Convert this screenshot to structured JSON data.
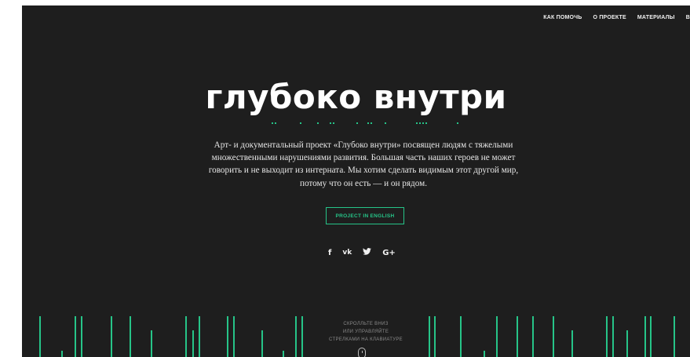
{
  "nav": {
    "items": [
      {
        "label": "КАК ПОМОЧЬ"
      },
      {
        "label": "О ПРОЕКТЕ"
      },
      {
        "label": "МАТЕРИАЛЫ"
      },
      {
        "label": "В"
      }
    ]
  },
  "hero": {
    "title": "глубоко внутри",
    "description": "Арт- и документальный проект «Глубоко внутри» посвящен людям с тяжелыми множественными нарушениями развития. Большая часть наших героев не может говорить и не выходит из интерната. Мы хотим сделать видимым этот другой мир, потому что он есть — и он рядом.",
    "button_label": "PROJECT IN ENGLISH"
  },
  "social": {
    "facebook": "f",
    "vk": "vk",
    "twitter": "🐦",
    "google": "G+"
  },
  "scroll_hint": {
    "line1": "СКРОЛЛЬТЕ ВНИЗ",
    "line2": "ИЛИ УПРАВЛЯЙТЕ",
    "line3": "СТРЕЛКАМИ НА КЛАВИАТУРЕ"
  },
  "colors": {
    "background": "#1e1e1e",
    "accent": "#26c488",
    "text": "#ffffff"
  },
  "icons": [
    "facebook-icon",
    "vk-icon",
    "twitter-icon",
    "google-plus-icon",
    "mouse-icon"
  ]
}
